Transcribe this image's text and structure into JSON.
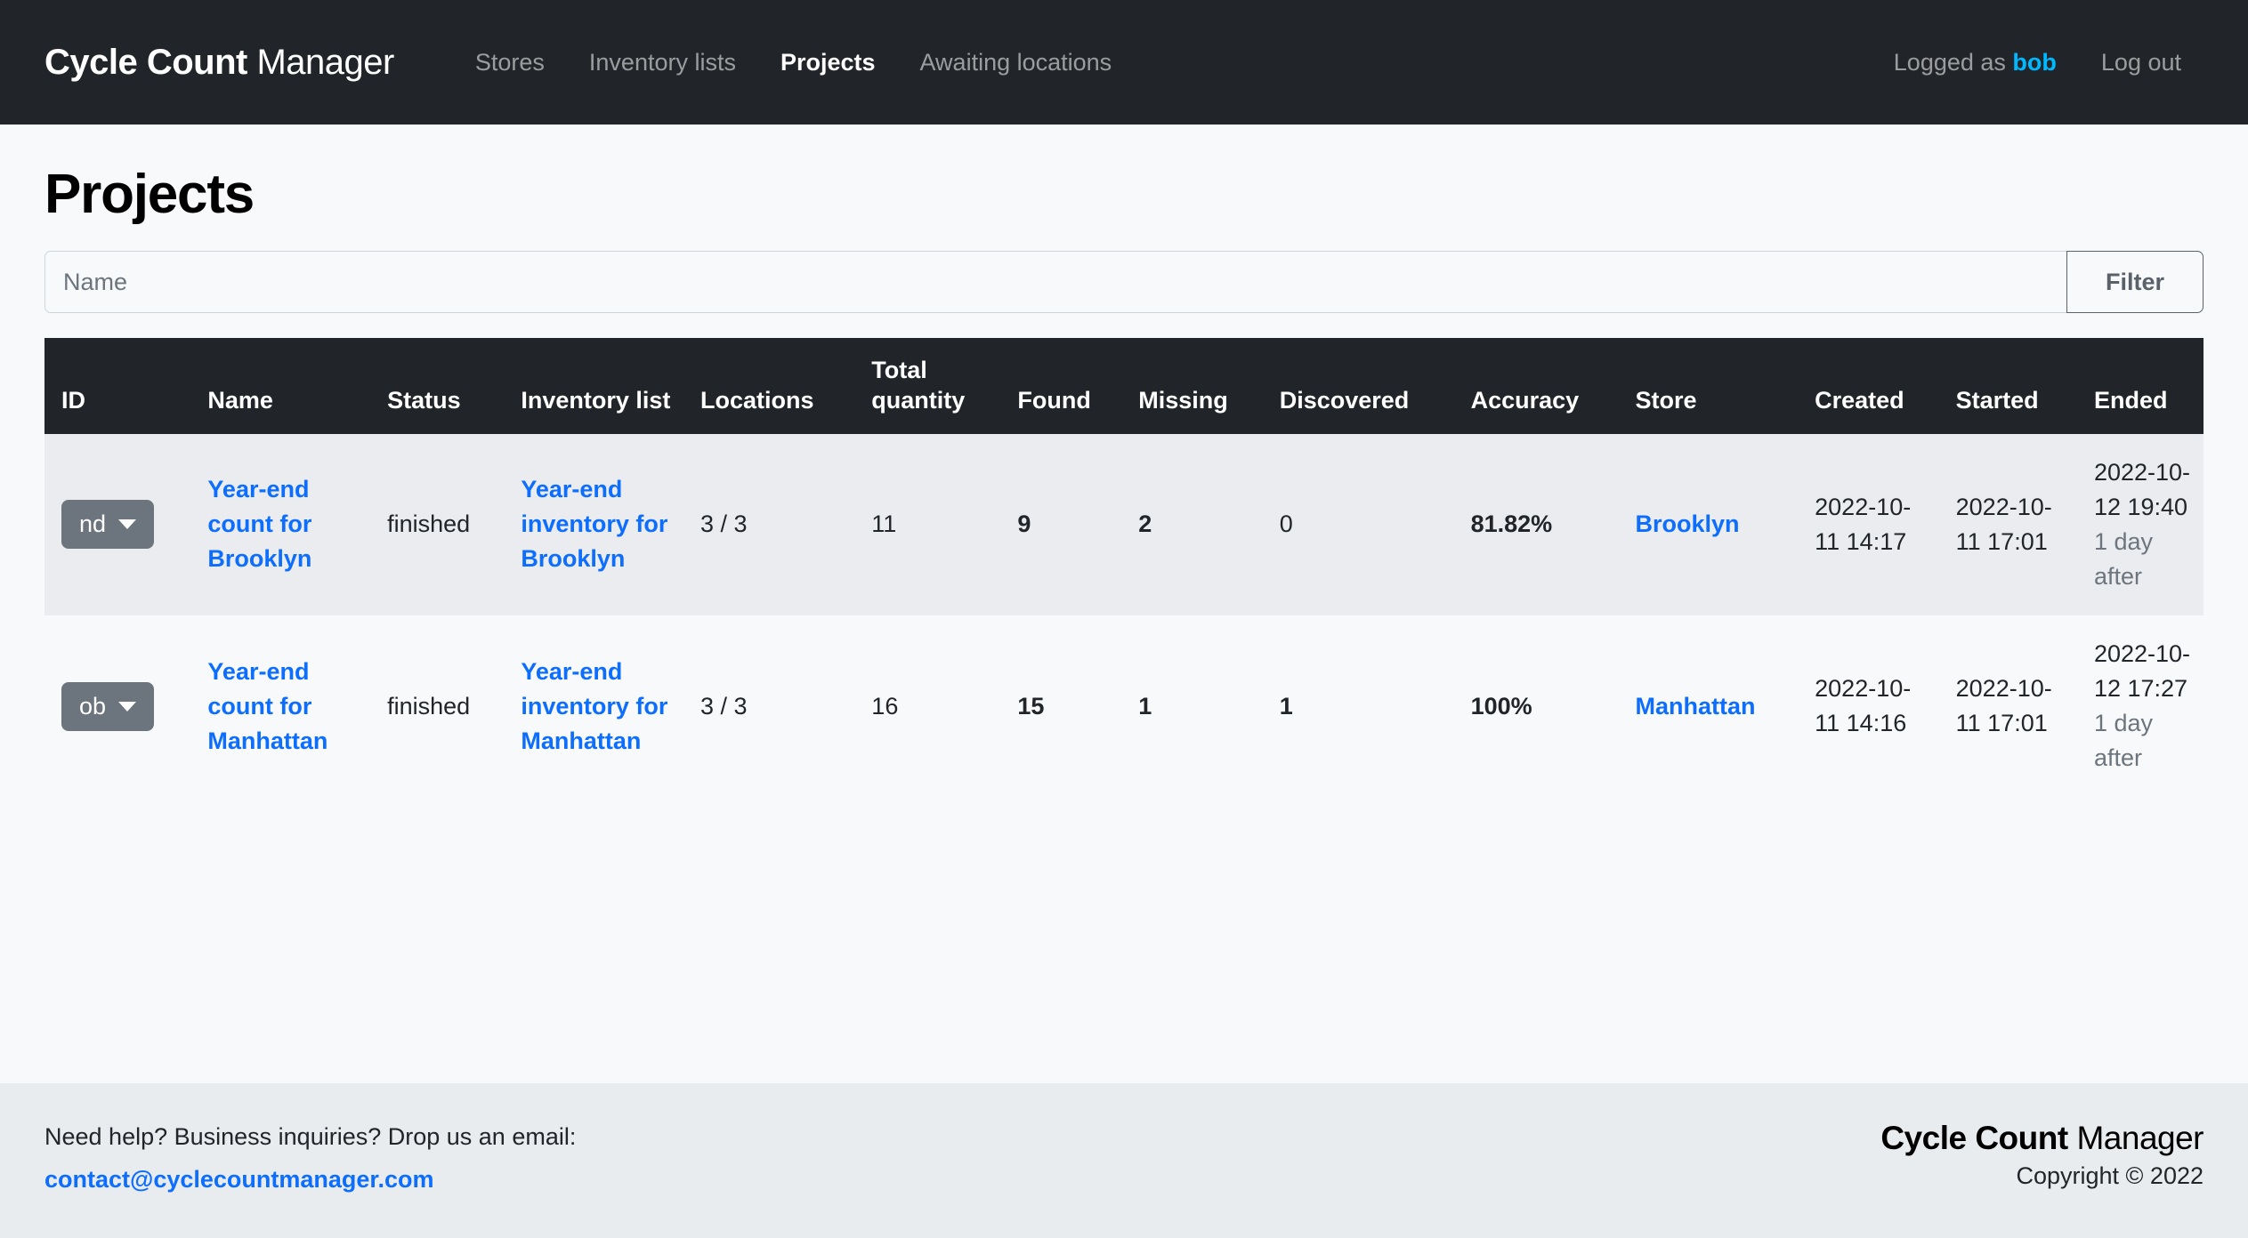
{
  "navbar": {
    "brand_strong": "Cycle Count",
    "brand_light": "Manager",
    "links": [
      {
        "label": "Stores",
        "active": false
      },
      {
        "label": "Inventory lists",
        "active": false
      },
      {
        "label": "Projects",
        "active": true
      },
      {
        "label": "Awaiting locations",
        "active": false
      }
    ],
    "logged_as_prefix": "Logged as",
    "username": "bob",
    "logout_label": "Log out",
    "accent_user_color": "#00b8ff",
    "background_color": "#212529"
  },
  "page": {
    "title": "Projects"
  },
  "filter": {
    "placeholder": "Name",
    "value": "",
    "button_label": "Filter"
  },
  "table": {
    "headers": [
      "ID",
      "Name",
      "Status",
      "Inventory list",
      "Locations",
      "Total quantity",
      "Found",
      "Missing",
      "Discovered",
      "Accuracy",
      "Store",
      "Created",
      "Started",
      "Ended"
    ],
    "rows": [
      {
        "id_label": "nd",
        "name": "Year-end count for Brooklyn",
        "status": "finished",
        "inventory_list": "Year-end inventory for Brooklyn",
        "locations": "3 / 3",
        "total_quantity": "11",
        "found": "9",
        "missing": "2",
        "discovered": "0",
        "accuracy": "81.82%",
        "store": "Brooklyn",
        "created": "2022-10-11 14:17",
        "started": "2022-10-11 17:01",
        "ended": "2022-10-12 19:40",
        "ended_sub": "1 day after"
      },
      {
        "id_label": "ob",
        "name": "Year-end count for Manhattan",
        "status": "finished",
        "inventory_list": "Year-end inventory for Manhattan",
        "locations": "3 / 3",
        "total_quantity": "16",
        "found": "15",
        "missing": "1",
        "discovered": "1",
        "accuracy": "100%",
        "store": "Manhattan",
        "created": "2022-10-11 14:16",
        "started": "2022-10-11 17:01",
        "ended": "2022-10-12 17:27",
        "ended_sub": "1 day after"
      }
    ]
  },
  "footer": {
    "help_text": "Need help? Business inquiries? Drop us an email:",
    "email": "contact@cyclecountmanager.com",
    "brand_strong": "Cycle Count",
    "brand_light": "Manager",
    "copyright": "Copyright © 2022"
  },
  "colors": {
    "link": "#0d6efd",
    "success": "#198754",
    "danger": "#b02a37",
    "muted": "#6c757d",
    "dark": "#212529"
  }
}
